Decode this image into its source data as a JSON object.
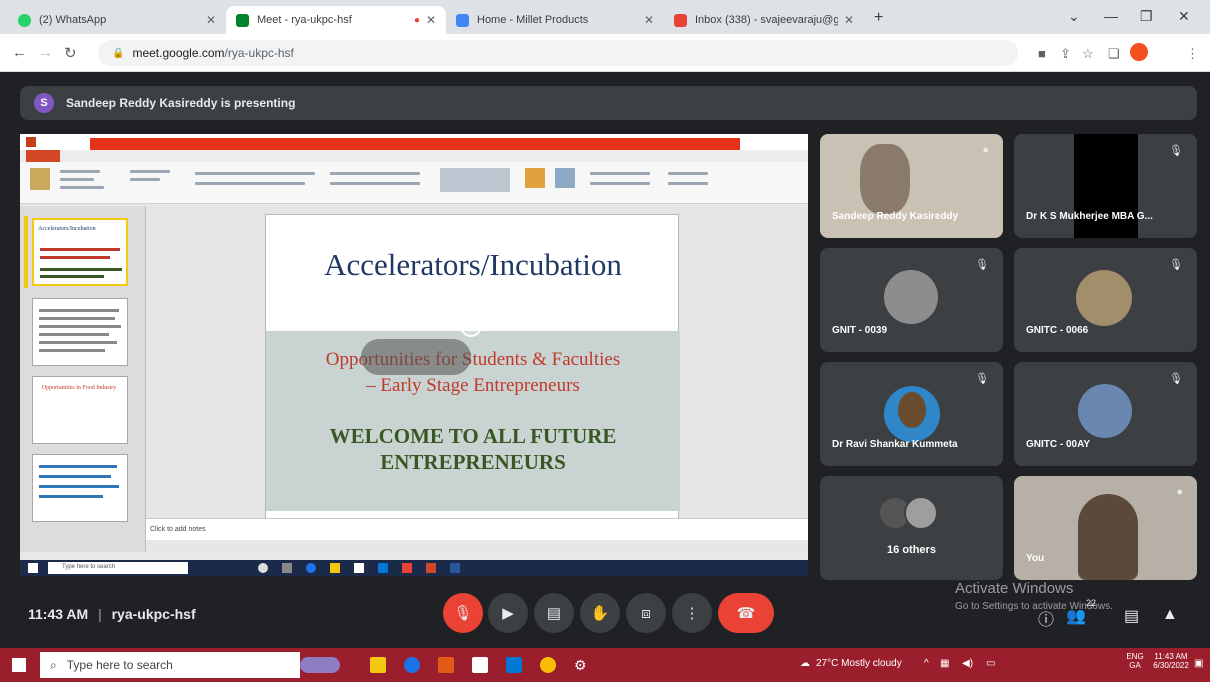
{
  "browser": {
    "tabs": [
      {
        "title": "(2) WhatsApp",
        "active": false,
        "favicon_color": "#25d366"
      },
      {
        "title": "Meet - rya-ukpc-hsf",
        "active": true,
        "favicon_color": "#00832d"
      },
      {
        "title": "Home - Millet Products",
        "active": false,
        "favicon_color": "#4285f4"
      },
      {
        "title": "Inbox (338) - svajeevaraju@gm...",
        "active": false,
        "favicon_color": "#ea4335"
      }
    ],
    "new_tab": "+",
    "url_domain": "meet.google.com",
    "url_path": "/rya-ukpc-hsf"
  },
  "meet": {
    "presenter_initial": "S",
    "presenter_text": "Sandeep Reddy Kasireddy is presenting",
    "shared_slide": {
      "title": "Accelerators/Incubation",
      "subtitle_line1": "Opportunities for Students & Faculties",
      "subtitle_line2": "– Early Stage Entrepreneurs",
      "welcome_line1": "WELCOME TO ALL FUTURE",
      "welcome_line2": "ENTREPRENEURS",
      "notes_placeholder": "Click to add notes",
      "inner_search": "Type here to search",
      "thumbnail_label": "Accelerators/Incubation",
      "thumbnail2_label": "Opportunities in Food Industry"
    },
    "participants": [
      {
        "name": "Sandeep Reddy Kasireddy",
        "color": "#d9d3c9"
      },
      {
        "name": "Dr K S Mukherjee MBA G...",
        "color": "#000000"
      },
      {
        "name": "GNIT - 0039",
        "color": "#8d8d8d"
      },
      {
        "name": "GNITC - 0066",
        "color": "#a38e6b"
      },
      {
        "name": "Dr Ravi Shankar Kummeta",
        "color": "#2f86c8"
      },
      {
        "name": "GNITC - 00AY",
        "color": "#6a87b2"
      }
    ],
    "others": "16 others",
    "self_label": "You",
    "time": "11:43 AM",
    "meeting_code": "rya-ukpc-hsf",
    "participant_count": "22",
    "watermark_title": "Activate Windows",
    "watermark_sub": "Go to Settings to activate Windows."
  },
  "taskbar": {
    "search_placeholder": "Type here to search",
    "weather": "27°C  Mostly cloudy",
    "lang": "ENG",
    "region": "GA",
    "clock_time": "11:43 AM",
    "clock_date": "6/30/2022"
  }
}
